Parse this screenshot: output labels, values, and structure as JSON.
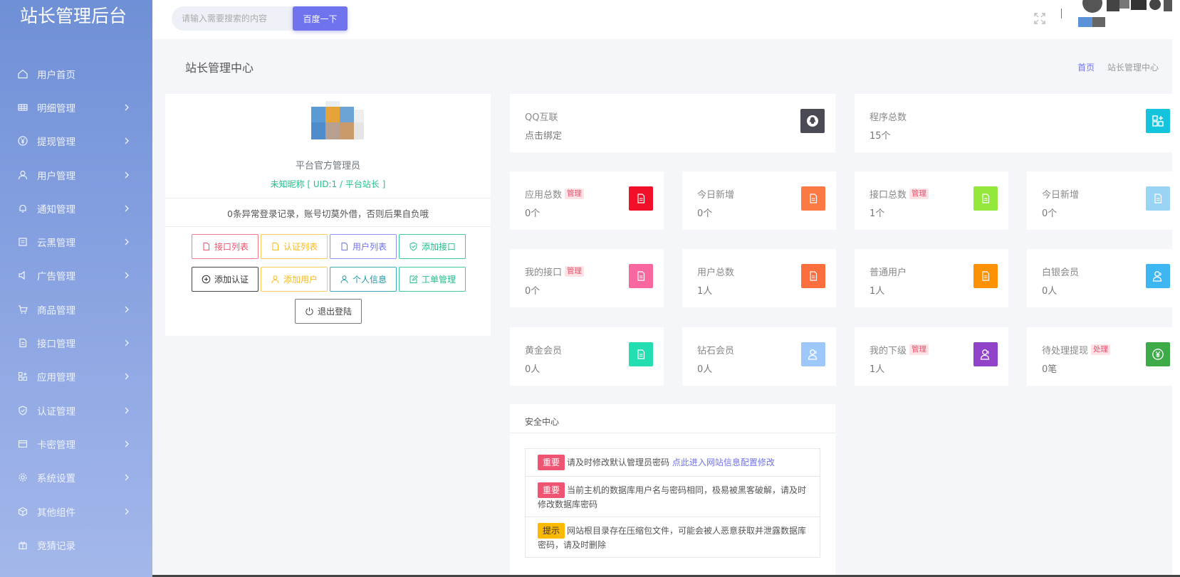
{
  "brand": {
    "title": "站长管理后台"
  },
  "sidebar": {
    "items": [
      {
        "label": "用户首页",
        "icon": "home-icon",
        "chevron": false
      },
      {
        "label": "明细管理",
        "icon": "list-icon",
        "chevron": true
      },
      {
        "label": "提现管理",
        "icon": "yen-icon",
        "chevron": true
      },
      {
        "label": "用户管理",
        "icon": "user-icon",
        "chevron": true
      },
      {
        "label": "通知管理",
        "icon": "bell-icon",
        "chevron": true
      },
      {
        "label": "云黑管理",
        "icon": "cloud-icon",
        "chevron": true
      },
      {
        "label": "广告管理",
        "icon": "speaker-icon",
        "chevron": true
      },
      {
        "label": "商品管理",
        "icon": "cart-icon",
        "chevron": true
      },
      {
        "label": "接口管理",
        "icon": "document-icon",
        "chevron": true
      },
      {
        "label": "应用管理",
        "icon": "apps-icon",
        "chevron": true
      },
      {
        "label": "认证管理",
        "icon": "shield-icon",
        "chevron": true
      },
      {
        "label": "卡密管理",
        "icon": "card-icon",
        "chevron": true
      },
      {
        "label": "系统设置",
        "icon": "gear-icon",
        "chevron": true
      },
      {
        "label": "其他组件",
        "icon": "box-icon",
        "chevron": true
      },
      {
        "label": "竞猜记录",
        "icon": "gift-icon",
        "chevron": false
      }
    ]
  },
  "topbar": {
    "search_placeholder": "请输入需要搜索的内容",
    "search_button": "百度一下"
  },
  "page": {
    "title": "站长管理中心",
    "breadcrumb_home": "首页",
    "breadcrumb_current": "站长管理中心"
  },
  "profile": {
    "name": "平台官方管理员",
    "uid_line": "未知昵称 [ UID:1 / 平台站长 ]",
    "note": "0条异常登录记录，账号切莫外借，否则后果自负哦",
    "buttons": {
      "api_list": "接口列表",
      "auth_list": "认证列表",
      "user_list": "用户列表",
      "add_api": "添加接口",
      "add_auth": "添加认证",
      "add_user": "添加用户",
      "personal_info": "个人信息",
      "ticket_manage": "工单管理",
      "logout": "退出登陆"
    }
  },
  "stats": {
    "qq": {
      "title": "QQ互联",
      "value": "点击绑定",
      "color": "#4a4a55"
    },
    "programs": {
      "title": "程序总数",
      "value": "15个",
      "color": "#14c4dd"
    },
    "apps": {
      "title": "应用总数",
      "badge": "管理",
      "value": "0个",
      "color": "#f0102a"
    },
    "today_new_1": {
      "title": "今日新增",
      "value": "0个",
      "color": "#fb7a44"
    },
    "apis": {
      "title": "接口总数",
      "badge": "管理",
      "value": "1个",
      "color": "#93e83b"
    },
    "today_new_2": {
      "title": "今日新增",
      "value": "0个",
      "color": "#9ad4f5"
    },
    "my_apis": {
      "title": "我的接口",
      "badge": "管理",
      "value": "0个",
      "color": "#f8679f"
    },
    "total_users": {
      "title": "用户总数",
      "value": "1人",
      "color": "#fb6e3e"
    },
    "normal_users": {
      "title": "普通用户",
      "value": "1人",
      "color": "#fd9104"
    },
    "silver": {
      "title": "白银会员",
      "value": "0人",
      "color": "#3eb6f1"
    },
    "gold": {
      "title": "黄金会员",
      "value": "0人",
      "color": "#22deb0"
    },
    "diamond": {
      "title": "钻石会员",
      "value": "0人",
      "color": "#9ec8fa"
    },
    "subordinates": {
      "title": "我的下级",
      "badge": "管理",
      "value": "1人",
      "color": "#9043c9"
    },
    "withdraw": {
      "title": "待处理提现",
      "badge": "处理",
      "value": "0笔",
      "color": "#3cab48"
    }
  },
  "security": {
    "title": "安全中心",
    "items": [
      {
        "tag": "重要",
        "text": "请及时修改默认管理员密码 ",
        "link": "点此进入网站信息配置修改"
      },
      {
        "tag": "重要",
        "text": "当前主机的数据库用户名与密码相同，极易被黑客破解，请及时修改数据库密码"
      },
      {
        "tag": "提示",
        "text": "网站根目录存在压缩包文件，可能会被人恶意获取并泄露数据库密码，请及时删除"
      }
    ]
  }
}
